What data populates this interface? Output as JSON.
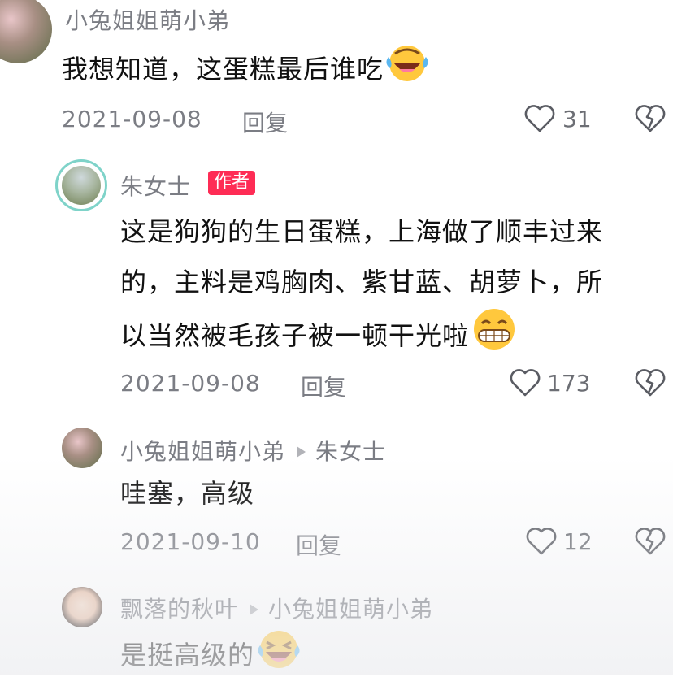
{
  "comments": [
    {
      "username": "小兔姐姐萌小弟",
      "text": "我想知道，这蛋糕最后谁吃",
      "emoji": "crying-laughing-face",
      "date": "2021-09-08",
      "reply_label": "回复",
      "likes": "31"
    },
    {
      "username": "朱女士",
      "badge": "作者",
      "text_line1": "这是狗狗的生日蛋糕，上海做了顺丰过来",
      "text_line2": "的，主料是鸡胸肉、紫甘蓝、胡萝卜，所",
      "text_line3": "以当然被毛孩子被一顿干光啦",
      "emoji": "grinning-face",
      "date": "2021-09-08",
      "reply_label": "回复",
      "likes": "173"
    },
    {
      "username": "小兔姐姐萌小弟",
      "reply_to": "朱女士",
      "text": "哇塞，高级",
      "date": "2021-09-10",
      "reply_label": "回复",
      "likes": "12"
    },
    {
      "username": "飘落的秋叶",
      "reply_to": "小兔姐姐萌小弟",
      "text": "是挺高级的",
      "emoji": "laughing-face"
    }
  ],
  "colors": {
    "badge": "#fe2c55",
    "meta_text": "#7b7d84",
    "main_text": "#111111"
  }
}
